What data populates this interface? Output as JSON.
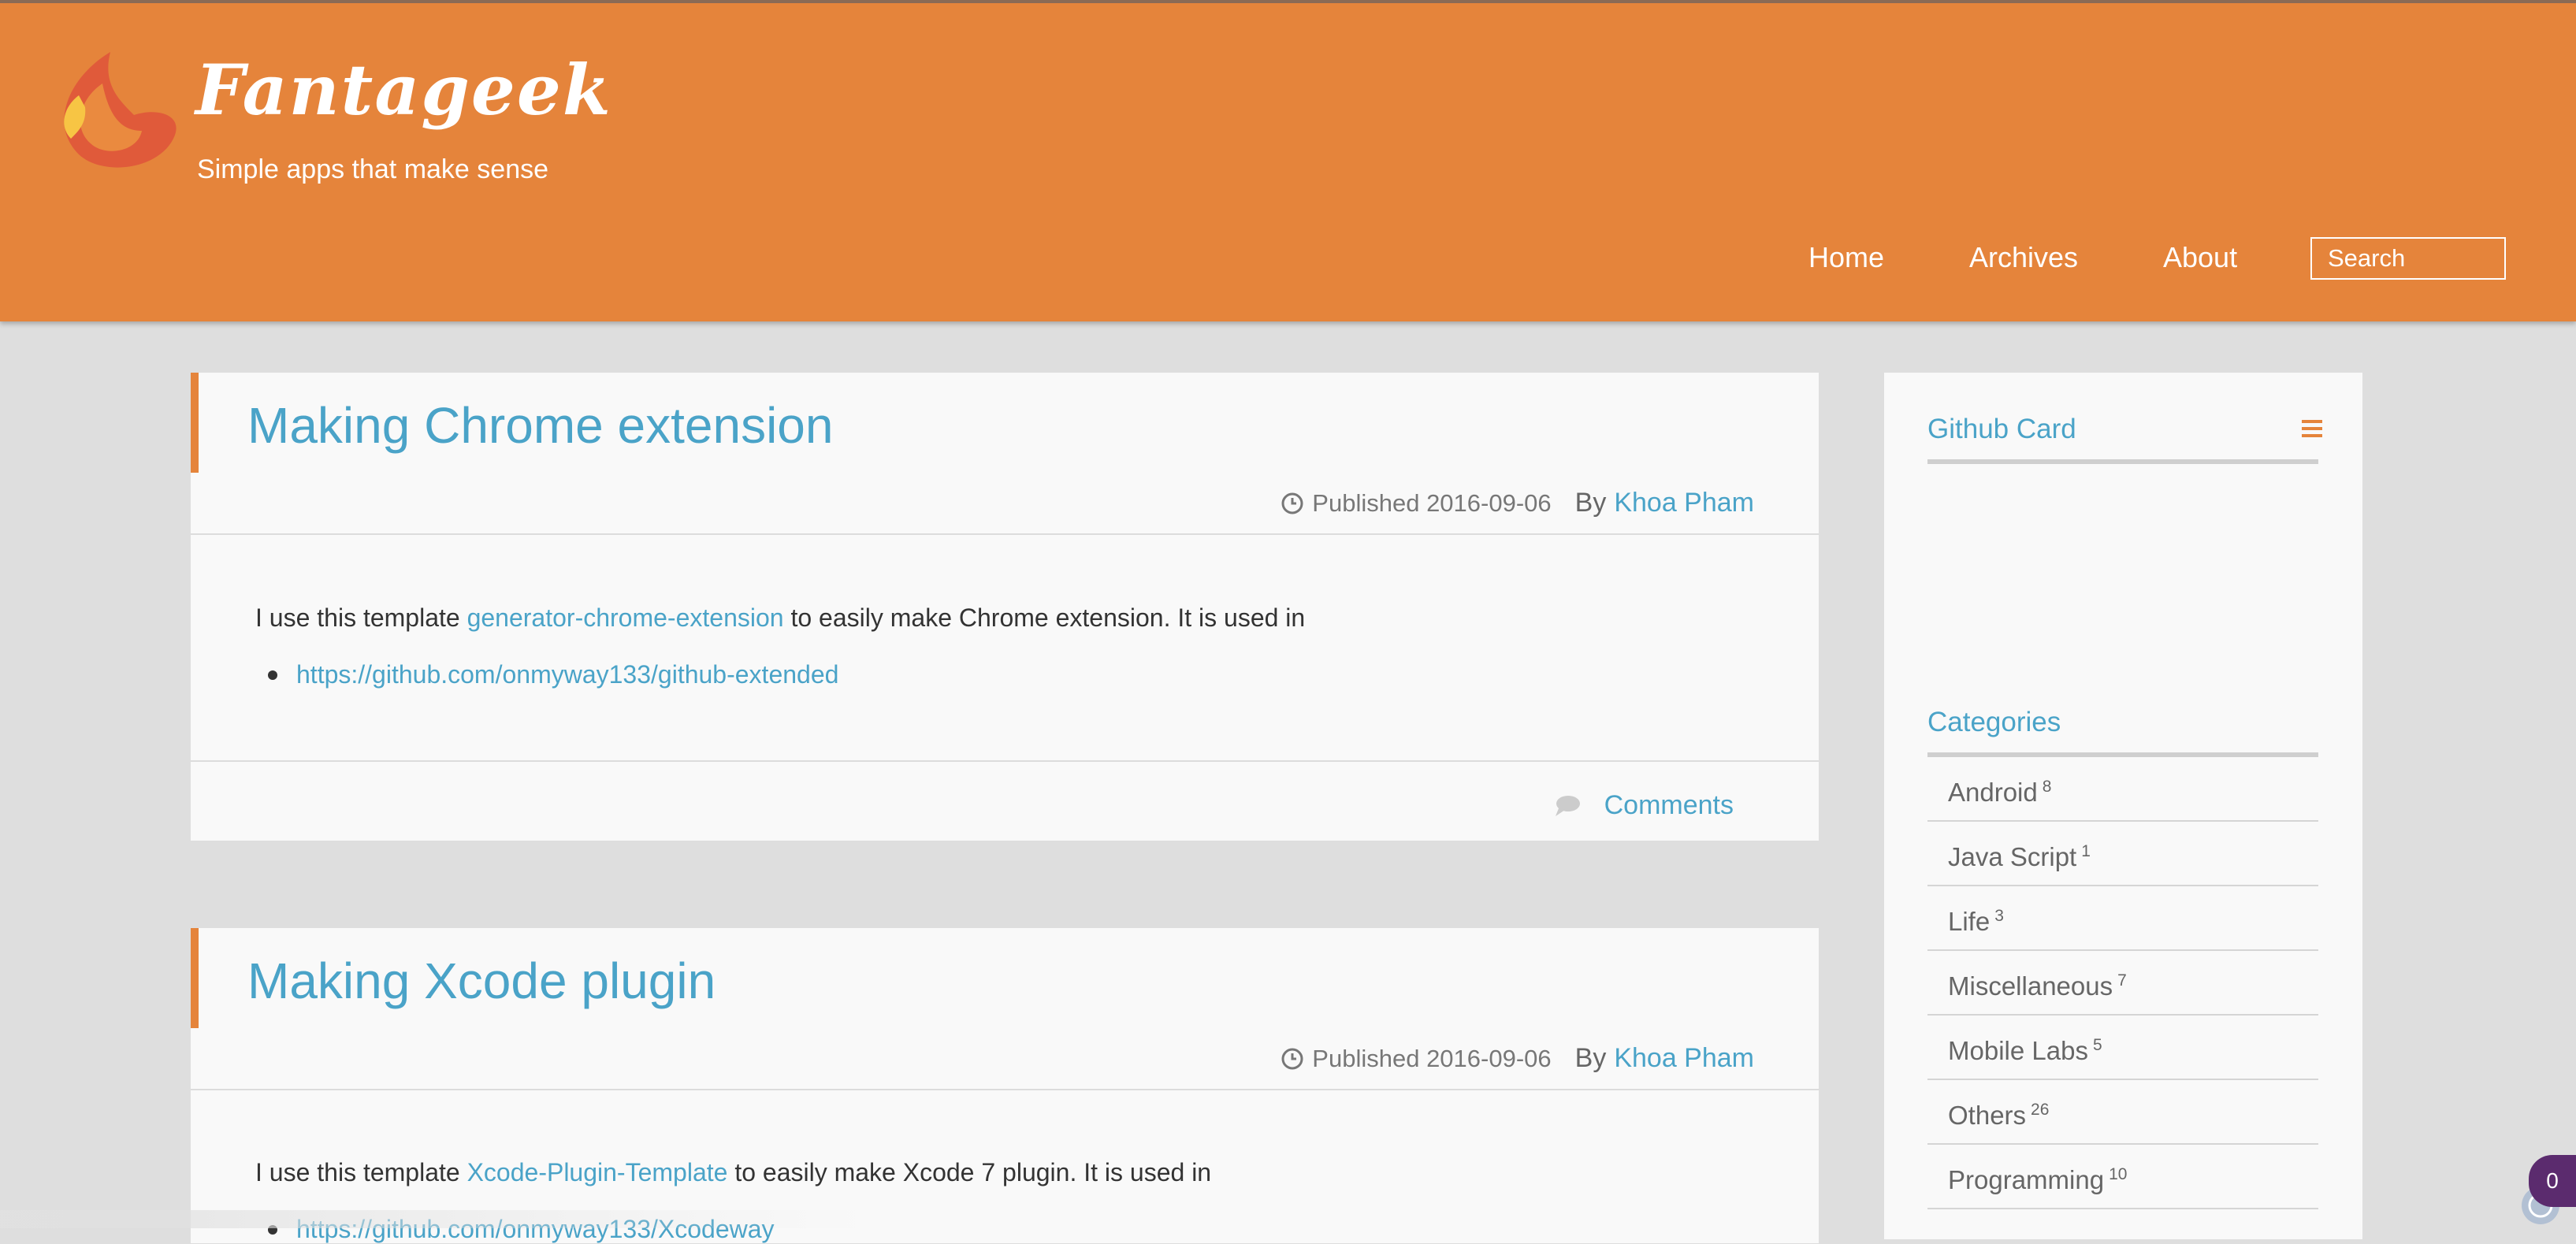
{
  "header": {
    "site_title": "Fantageek",
    "tagline": "Simple apps that make sense",
    "logo_icon": "flame-logo-icon",
    "brand_color": "#e5843b",
    "nav": [
      {
        "label": "Home"
      },
      {
        "label": "Archives"
      },
      {
        "label": "About"
      }
    ],
    "search_placeholder": "Search"
  },
  "posts": [
    {
      "title": "Making Chrome extension",
      "published": "Published 2016-09-06",
      "by": "By",
      "author": "Khoa Pham",
      "body_prefix": "I use this template ",
      "body_link": "generator-chrome-extension",
      "body_suffix": " to easily make Chrome extension. It is used in",
      "bullet_link": "https://github.com/onmyway133/github-extended",
      "comments_label": "Comments"
    },
    {
      "title": "Making Xcode plugin",
      "published": "Published 2016-09-06",
      "by": "By",
      "author": "Khoa Pham",
      "body_prefix": "I use this template ",
      "body_link": "Xcode-Plugin-Template",
      "body_suffix": " to easily make Xcode 7 plugin. It is used in",
      "bullet_link": "https://github.com/onmyway133/Xcodeway"
    }
  ],
  "sidebar": {
    "github_card_title": "Github Card",
    "categories_title": "Categories",
    "categories": [
      {
        "name": "Android",
        "count": "8"
      },
      {
        "name": "Java Script",
        "count": "1"
      },
      {
        "name": "Life",
        "count": "3"
      },
      {
        "name": "Miscellaneous",
        "count": "7"
      },
      {
        "name": "Mobile Labs",
        "count": "5"
      },
      {
        "name": "Others",
        "count": "26"
      },
      {
        "name": "Programming",
        "count": "10"
      }
    ]
  },
  "badge": {
    "count": "0"
  }
}
